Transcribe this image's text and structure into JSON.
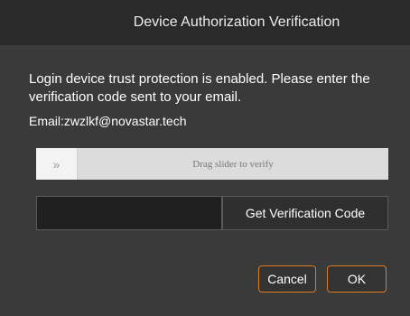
{
  "dialog": {
    "title": "Device Authorization Verification",
    "message": "Login device trust protection is enabled. Please enter the verification code sent to your email.",
    "email": "Email:zwzlkf@novastar.tech"
  },
  "slider": {
    "handle_glyph": "»",
    "hint": "Drag slider to verify",
    "progress_percent": 0
  },
  "verification": {
    "code_value": "",
    "code_placeholder": "",
    "get_code_label": "Get Verification Code"
  },
  "actions": {
    "cancel_label": "Cancel",
    "ok_label": "OK"
  },
  "colors": {
    "accent": "#e07b22",
    "background": "#3a3a3a",
    "titlebar": "#2a2a2a"
  }
}
